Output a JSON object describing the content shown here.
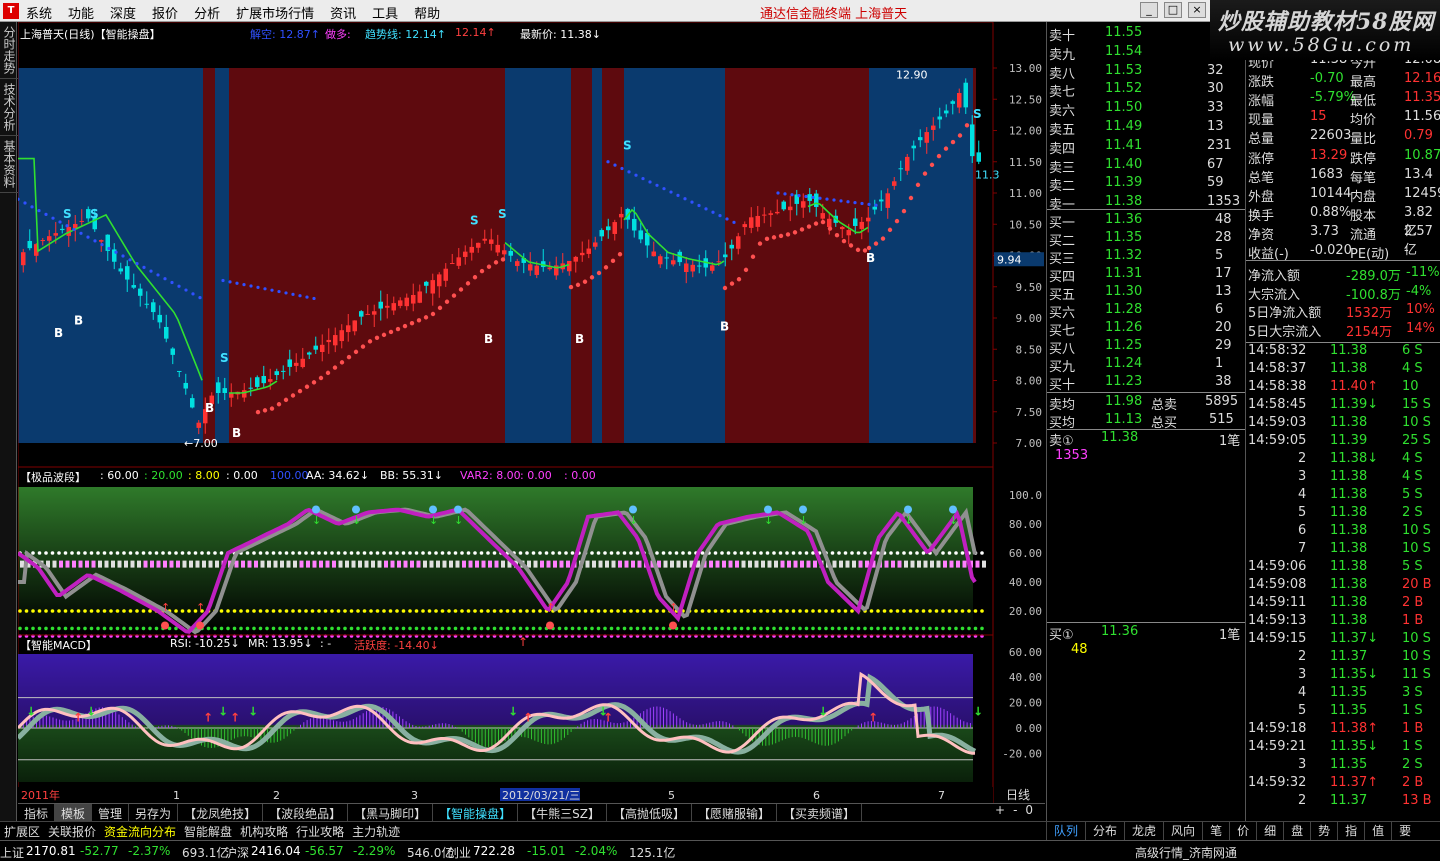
{
  "menu": {
    "items": [
      "系统",
      "功能",
      "深度",
      "报价",
      "分析",
      "扩展市场行情",
      "资讯",
      "工具",
      "帮助"
    ],
    "title": "通达信金融终端 上海普天"
  },
  "watermark": {
    "line1": "炒股辅助教材58股网",
    "line2": "www.58Gu.com"
  },
  "side_tabs": [
    "分时走势",
    "技术分析",
    "基本资料"
  ],
  "main_chart": {
    "name": "上海普天(日线)【智能操盘】",
    "ind_a": "解空: 12.87↑",
    "ind_b": "做多:",
    "ind_c": "趋势线: 12.14↑",
    "ind_d": "12.14↑",
    "ind_e": "最新价: 11.38↓",
    "ylabels": [
      "13.00",
      "12.50",
      "12.00",
      "11.50",
      "11.00",
      "10.50",
      "10.00",
      "9.50",
      "9.00",
      "8.50",
      "8.00",
      "7.50",
      "7.00"
    ],
    "cur_price": "9.94",
    "high_label": "12.90",
    "low_label": "7.00",
    "side_label": "11.3",
    "signal_s": "S",
    "signal_b": "B"
  },
  "wave_chart": {
    "name": "【极品波段】",
    "vals": [
      ": 60.00",
      ": 20.00",
      ": 8.00",
      ": 0.00",
      "100.00",
      "AA: 34.62↓",
      "BB: 55.31↓",
      "VAR2: 8.00",
      ": 0.00",
      ": 0.00"
    ],
    "ylabels": [
      "100.0",
      "80.00",
      "60.00",
      "40.00",
      "20.00"
    ]
  },
  "macd_chart": {
    "name": "【智能MACD】",
    ": 0.00": ": 0.00",
    "rsi": "RSI: -10.25↓",
    "mr": "MR: 13.95↓",
    "dash": ": -",
    "active": "活跃度: -14.40↓",
    "ylabels": [
      "60.00",
      "40.00",
      "20.00",
      "0.00",
      "-20.00"
    ]
  },
  "xaxis": {
    "labels": [
      "2011年",
      "1",
      "2",
      "3",
      "2012/03/21/三",
      "5",
      "6",
      "7"
    ],
    "period": "日线"
  },
  "quote": {
    "sells": [
      [
        "卖十",
        "11.55",
        ""
      ],
      [
        "卖九",
        "11.54",
        ""
      ],
      [
        "卖八",
        "11.53",
        "32"
      ],
      [
        "卖七",
        "11.52",
        "30"
      ],
      [
        "卖六",
        "11.50",
        "33"
      ],
      [
        "卖五",
        "11.49",
        "13"
      ],
      [
        "卖四",
        "11.41",
        "231"
      ],
      [
        "卖三",
        "11.40",
        "67"
      ],
      [
        "卖二",
        "11.39",
        "59"
      ],
      [
        "卖一",
        "11.38",
        "1353"
      ]
    ],
    "buys": [
      [
        "买一",
        "11.36",
        "48"
      ],
      [
        "买二",
        "11.35",
        "28"
      ],
      [
        "买三",
        "11.32",
        "5"
      ],
      [
        "买四",
        "11.31",
        "17"
      ],
      [
        "买五",
        "11.30",
        "13"
      ],
      [
        "买六",
        "11.28",
        "6"
      ],
      [
        "买七",
        "11.26",
        "20"
      ],
      [
        "买八",
        "11.25",
        "29"
      ],
      [
        "买九",
        "11.24",
        "1"
      ],
      [
        "买十",
        "11.23",
        "38"
      ]
    ],
    "avg_sell": [
      "卖均",
      "11.98",
      "总卖",
      "5895"
    ],
    "avg_buy": [
      "买均",
      "11.13",
      "总买",
      "515"
    ],
    "sell1": [
      "卖①",
      "11.38",
      "1笔",
      "1353"
    ],
    "buy1": [
      "买①",
      "11.36",
      "1笔",
      "48"
    ],
    "stats": [
      [
        "现价",
        "11.38",
        "今开",
        "12.08"
      ],
      [
        "涨跌",
        "-0.70",
        "最高",
        "12.16"
      ],
      [
        "涨幅",
        "-5.79%",
        "最低",
        "11.35"
      ],
      [
        "现量",
        "15",
        "均价",
        "11.56"
      ],
      [
        "总量",
        "22603",
        "量比",
        "0.79"
      ],
      [
        "涨停",
        "13.29",
        "跌停",
        "10.87"
      ],
      [
        "总笔",
        "1683",
        "每笔",
        "13.4"
      ],
      [
        "外盘",
        "10144",
        "内盘",
        "12459"
      ],
      [
        "换手",
        "0.88%",
        "股本",
        "3.82亿"
      ],
      [
        "净资",
        "3.73",
        "流通",
        "2.57亿"
      ],
      [
        "收益(-)",
        "-0.020",
        "PE(动)",
        "-"
      ]
    ],
    "flows": [
      [
        "净流入额",
        "-289.0万",
        "-11%"
      ],
      [
        "大宗流入",
        "-100.8万",
        "-4%"
      ],
      [
        "5日净流入额",
        "1532万",
        "10%"
      ],
      [
        "5日大宗流入",
        "2154万",
        "14%"
      ]
    ],
    "ticks": [
      [
        "14:58:32",
        "11.38",
        "6 S"
      ],
      [
        "14:58:37",
        "11.38",
        "4 S"
      ],
      [
        "14:58:38",
        "11.40↑",
        "10"
      ],
      [
        "14:58:45",
        "11.39↓",
        "15 S"
      ],
      [
        "14:59:03",
        "11.38",
        "10 S"
      ],
      [
        "14:59:05",
        "11.39",
        "25 S"
      ],
      [
        "2",
        "11.38↓",
        "4 S"
      ],
      [
        "3",
        "11.38",
        "4 S"
      ],
      [
        "4",
        "11.38",
        "5 S"
      ],
      [
        "5",
        "11.38",
        "2 S"
      ],
      [
        "6",
        "11.38",
        "10 S"
      ],
      [
        "7",
        "11.38",
        "10 S"
      ],
      [
        "14:59:06",
        "11.38",
        "5 S"
      ],
      [
        "14:59:08",
        "11.38",
        "20 B"
      ],
      [
        "14:59:11",
        "11.38",
        "2 B"
      ],
      [
        "14:59:13",
        "11.38",
        "1 B"
      ],
      [
        "14:59:15",
        "11.37↓",
        "10 S"
      ],
      [
        "2",
        "11.37",
        "10 S"
      ],
      [
        "3",
        "11.35↓",
        "11 S"
      ],
      [
        "4",
        "11.35",
        "3 S"
      ],
      [
        "5",
        "11.35",
        "1 S"
      ],
      [
        "14:59:18",
        "11.38↑",
        "1 B"
      ],
      [
        "14:59:21",
        "11.35↓",
        "1 S"
      ],
      [
        "3",
        "11.35",
        "2 S"
      ],
      [
        "14:59:32",
        "11.37↑",
        "2 B"
      ],
      [
        "2",
        "11.37",
        "13 B"
      ]
    ]
  },
  "bottom_tabs": [
    "指标",
    "模板",
    "管理",
    "另存为",
    "【龙凤绝技】",
    "【波段绝品】",
    "【黑马脚印】",
    "【智能操盘】",
    "【牛熊三SZ】",
    "【高抛低吸】",
    "【愿赌服输】",
    "【买卖频谱】"
  ],
  "bottom_ctrl": [
    "+",
    "-",
    "0"
  ],
  "toolbar": [
    "扩展区",
    "关联报价",
    "资金流向分布",
    "智能解盘",
    "机构攻略",
    "行业攻略",
    "主力轨迹"
  ],
  "right_tabs": [
    "队列",
    "分布",
    "龙虎",
    "风向",
    "笔",
    "价",
    "细",
    "盘",
    "势",
    "指",
    "值",
    "要"
  ],
  "status": [
    [
      "上证",
      "2170.81",
      "-52.77",
      "-2.37%",
      "693.1亿"
    ],
    [
      "沪深",
      "2416.04",
      "-56.57",
      "-2.29%",
      "546.0亿"
    ],
    [
      "创业",
      "722.28",
      "-15.01",
      "-2.04%",
      "125.1亿"
    ]
  ],
  "network": "高级行情_济南网通",
  "colors": {
    "up": "#ff3232",
    "down": "#00e0e0",
    "ma": "#30e030",
    "bg_red": "#5e0a0e",
    "bg_blue": "#0a3a6e"
  }
}
